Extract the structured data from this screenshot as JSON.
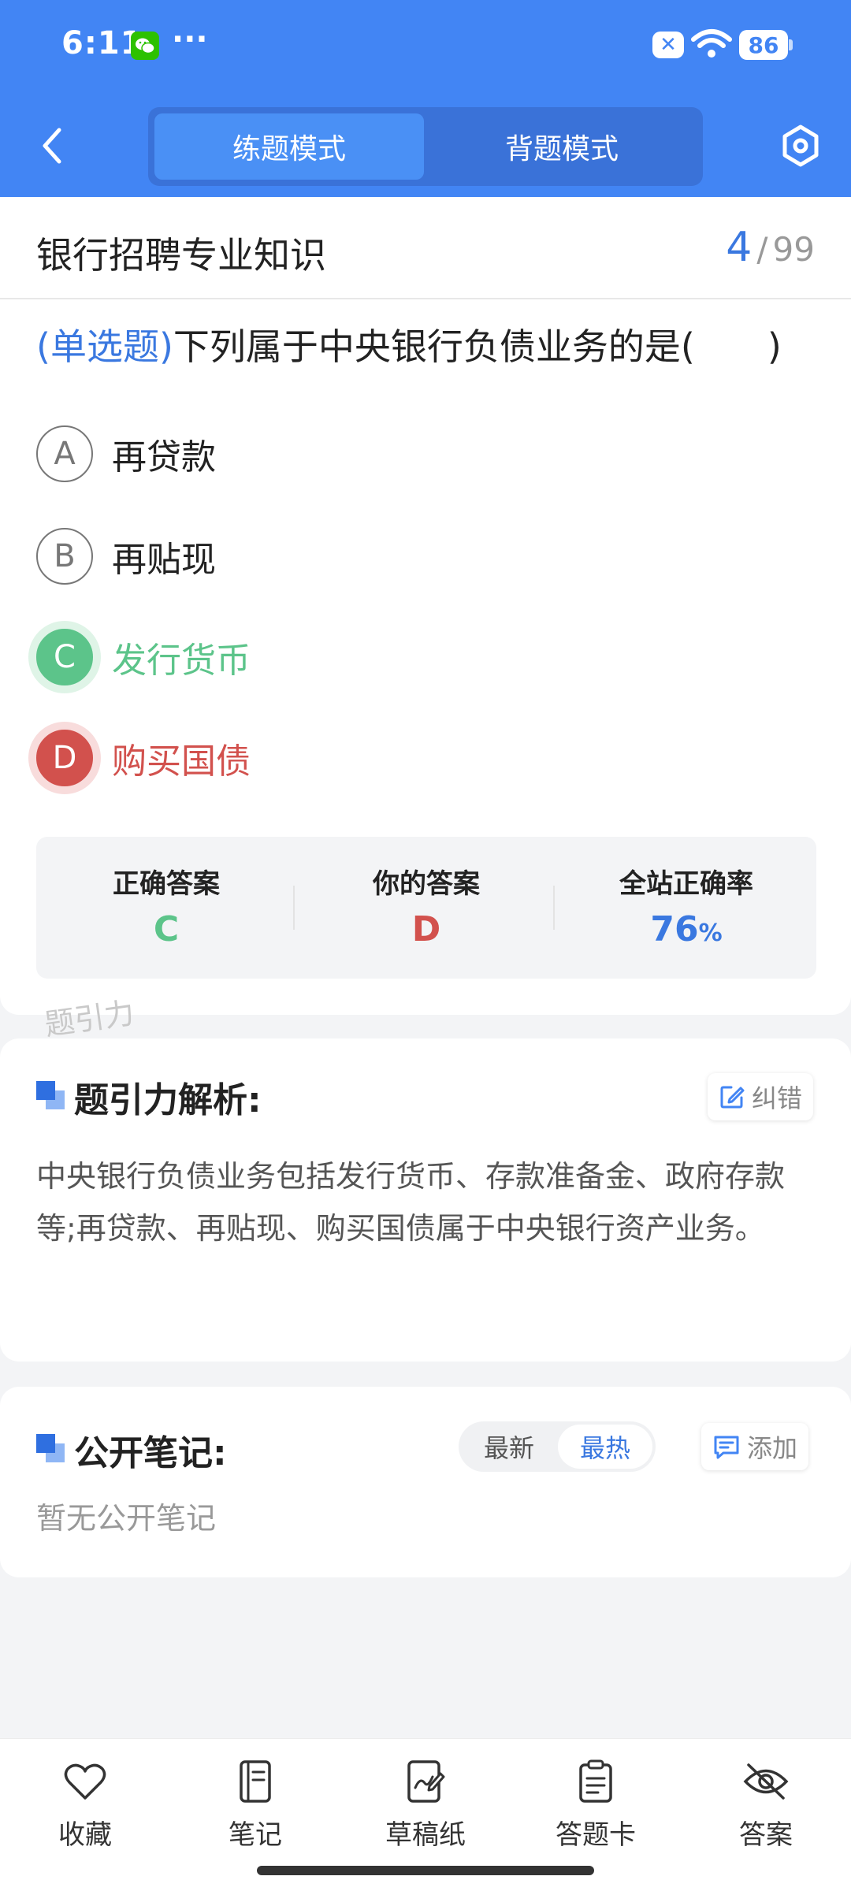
{
  "status_bar": {
    "time": "6:11",
    "dots": "···",
    "battery": "86",
    "x_badge": "✕"
  },
  "nav": {
    "tabs": [
      {
        "label": "练题模式",
        "active": true
      },
      {
        "label": "背题模式",
        "active": false
      }
    ]
  },
  "question": {
    "subject": "银行招聘专业知识",
    "current": "4",
    "separator": "/",
    "total": "99",
    "type_label": "(单选题)",
    "text": "下列属于中央银行负债业务的是(　　)",
    "options": [
      {
        "letter": "A",
        "text": "再贷款",
        "state": "normal"
      },
      {
        "letter": "B",
        "text": "再贴现",
        "state": "normal"
      },
      {
        "letter": "C",
        "text": "发行货币",
        "state": "correct"
      },
      {
        "letter": "D",
        "text": "购买国债",
        "state": "wrong"
      }
    ]
  },
  "result": {
    "correct_label": "正确答案",
    "correct_value": "C",
    "yours_label": "你的答案",
    "yours_value": "D",
    "rate_label": "全站正确率",
    "rate_value": "76",
    "rate_unit": "%"
  },
  "watermark": "题引力",
  "analysis": {
    "title": "题引力解析:",
    "report_label": "纠错",
    "text": "中央银行负债业务包括发行货币、存款准备金、政府存款等;再贷款、再贴现、购买国债属于中央银行资产业务。"
  },
  "notes": {
    "title": "公开笔记:",
    "sort_latest": "最新",
    "sort_hot": "最热",
    "add_label": "添加",
    "empty_text": "暂无公开笔记"
  },
  "bottom_bar": {
    "items": [
      {
        "label": "收藏",
        "icon": "heart-icon"
      },
      {
        "label": "笔记",
        "icon": "notebook-icon"
      },
      {
        "label": "草稿纸",
        "icon": "draft-icon"
      },
      {
        "label": "答题卡",
        "icon": "clipboard-icon"
      },
      {
        "label": "答案",
        "icon": "eye-off-icon"
      }
    ]
  },
  "colors": {
    "brand": "#4285f4",
    "correct": "#5cc48a",
    "wrong": "#d2514d",
    "accent_text": "#3a78e0"
  }
}
